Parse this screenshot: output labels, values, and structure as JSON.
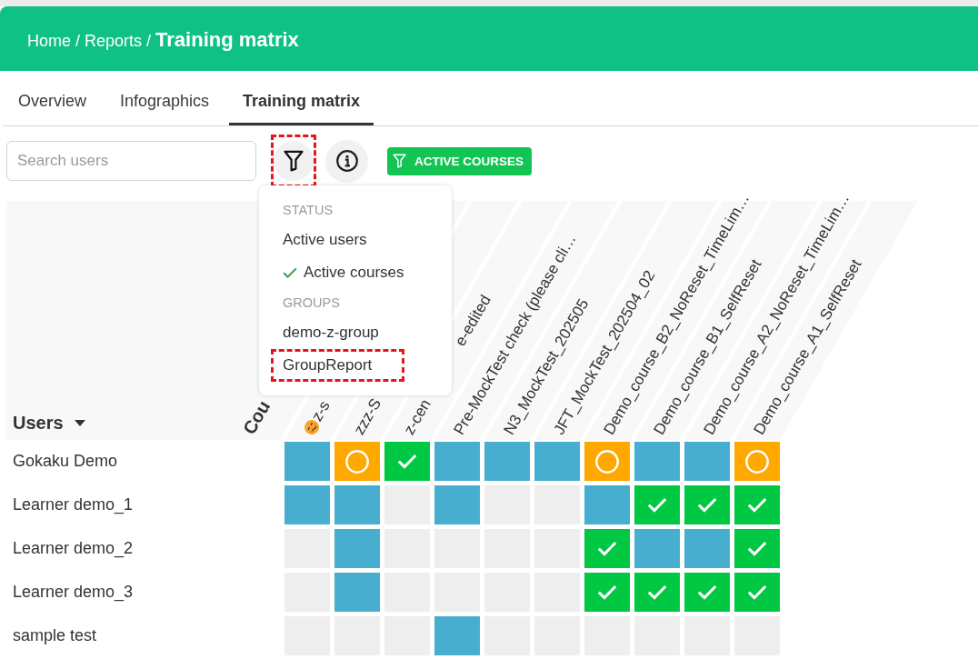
{
  "header": {
    "breadcrumb": [
      {
        "label": "Home",
        "separator": "/"
      },
      {
        "label": "Reports",
        "separator": "/"
      }
    ],
    "title": "Training matrix"
  },
  "tabs": [
    {
      "label": "Overview",
      "selected": false
    },
    {
      "label": "Infographics",
      "selected": false
    },
    {
      "label": "Training matrix",
      "selected": true
    }
  ],
  "toolbar": {
    "search": {
      "placeholder": "Search users"
    },
    "filter_button": {
      "highlighted": true
    },
    "chips": [
      {
        "label": "ACTIVE COURSES"
      }
    ]
  },
  "filter_menu": {
    "sections": [
      {
        "title": "STATUS",
        "items": [
          {
            "label": "Active users",
            "checked": false,
            "highlighted": false
          },
          {
            "label": "Active courses",
            "checked": true,
            "highlighted": false
          }
        ]
      },
      {
        "title": "GROUPS",
        "items": [
          {
            "label": "demo-z-group",
            "checked": false,
            "highlighted": false
          },
          {
            "label": "GroupReport",
            "checked": false,
            "highlighted": true
          }
        ]
      }
    ]
  },
  "matrix": {
    "users_header": "Users",
    "courses_header": "Cou",
    "columns": [
      {
        "kind": "emoji",
        "label_parts": [
          "z-s"
        ]
      },
      {
        "kind": "plain",
        "label_parts": [
          "zzz-S"
        ]
      },
      {
        "kind": "plain",
        "label_parts": [
          "z-cen",
          "e-edited"
        ]
      },
      {
        "kind": "plain",
        "label_parts": [
          "Pre-MockTest check (please cli…"
        ]
      },
      {
        "kind": "plain",
        "label_parts": [
          "N3_MockTest_202505"
        ]
      },
      {
        "kind": "plain",
        "label_parts": [
          "JFT_MockTest_202504_02"
        ]
      },
      {
        "kind": "plain",
        "label_parts": [
          "Demo_course_B2_NoReset_TimeLim…"
        ]
      },
      {
        "kind": "plain",
        "label_parts": [
          "Demo_course_B1_SelfReset"
        ]
      },
      {
        "kind": "plain",
        "label_parts": [
          "Demo_course_A2_NoReset_TimeLim…"
        ]
      },
      {
        "kind": "plain",
        "label_parts": [
          "Demo_course_A1_SelfReset"
        ]
      }
    ],
    "rows": [
      {
        "name": "Gokaku Demo",
        "cells": [
          {
            "kind": "not_started"
          },
          {
            "kind": "in_progress"
          },
          {
            "kind": "completed"
          },
          {
            "kind": "not_started"
          },
          {
            "kind": "not_started"
          },
          {
            "kind": "not_started"
          },
          {
            "kind": "in_progress"
          },
          {
            "kind": "not_started"
          },
          {
            "kind": "not_started"
          },
          {
            "kind": "in_progress"
          }
        ]
      },
      {
        "name": "Learner demo_1",
        "cells": [
          {
            "kind": "not_started"
          },
          {
            "kind": "not_started"
          },
          {
            "kind": "not_assigned"
          },
          {
            "kind": "not_started"
          },
          {
            "kind": "not_assigned"
          },
          {
            "kind": "not_assigned"
          },
          {
            "kind": "not_started"
          },
          {
            "kind": "completed"
          },
          {
            "kind": "completed"
          },
          {
            "kind": "completed"
          }
        ]
      },
      {
        "name": "Learner demo_2",
        "cells": [
          {
            "kind": "not_assigned"
          },
          {
            "kind": "not_started"
          },
          {
            "kind": "not_assigned"
          },
          {
            "kind": "not_assigned"
          },
          {
            "kind": "not_assigned"
          },
          {
            "kind": "not_assigned"
          },
          {
            "kind": "completed"
          },
          {
            "kind": "not_started"
          },
          {
            "kind": "not_started"
          },
          {
            "kind": "completed"
          }
        ]
      },
      {
        "name": "Learner demo_3",
        "cells": [
          {
            "kind": "not_assigned"
          },
          {
            "kind": "not_started"
          },
          {
            "kind": "not_assigned"
          },
          {
            "kind": "not_assigned"
          },
          {
            "kind": "not_assigned"
          },
          {
            "kind": "not_assigned"
          },
          {
            "kind": "completed"
          },
          {
            "kind": "completed"
          },
          {
            "kind": "completed"
          },
          {
            "kind": "completed"
          }
        ]
      },
      {
        "name": "sample test",
        "cells": [
          {
            "kind": "not_assigned"
          },
          {
            "kind": "not_assigned"
          },
          {
            "kind": "not_assigned"
          },
          {
            "kind": "not_started"
          },
          {
            "kind": "not_assigned"
          },
          {
            "kind": "not_assigned"
          },
          {
            "kind": "not_assigned"
          },
          {
            "kind": "not_assigned"
          },
          {
            "kind": "not_assigned"
          },
          {
            "kind": "not_assigned"
          }
        ]
      }
    ]
  }
}
